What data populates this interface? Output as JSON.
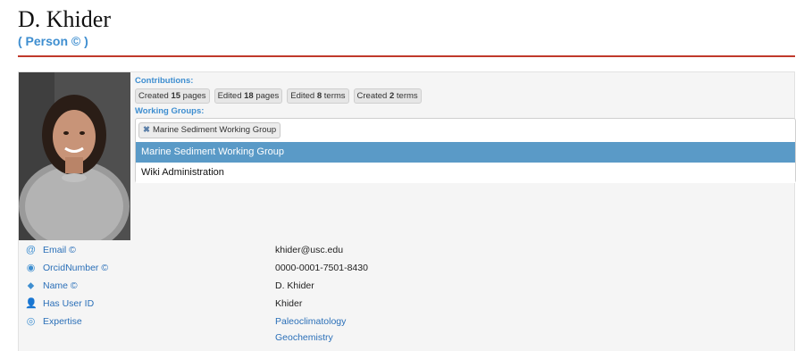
{
  "page": {
    "title": "D. Khider",
    "subtitle": "( Person © )"
  },
  "contributions": {
    "label": "Contributions:",
    "chips": [
      {
        "prefix": "Created",
        "count": "15",
        "suffix": "pages"
      },
      {
        "prefix": "Edited",
        "count": "18",
        "suffix": "pages"
      },
      {
        "prefix": "Edited",
        "count": "8",
        "suffix": "terms"
      },
      {
        "prefix": "Created",
        "count": "2",
        "suffix": "terms"
      }
    ]
  },
  "working_groups": {
    "label": "Working Groups:",
    "selected_token": "Marine Sediment Working Group",
    "remove_glyph": "✖",
    "options": [
      "Marine Sediment Working Group",
      "Wiki Administration"
    ]
  },
  "properties": [
    {
      "icon": "at-icon",
      "glyph": "@",
      "name": "Email ©",
      "values": [
        "khider@usc.edu"
      ]
    },
    {
      "icon": "orcid-icon",
      "glyph": "◉",
      "name": "OrcidNumber ©",
      "values": [
        "0000-0001-7501-8430"
      ]
    },
    {
      "icon": "tag-icon",
      "glyph": "⬥",
      "name": "Name ©",
      "values": [
        "D. Khider"
      ]
    },
    {
      "icon": "user-icon",
      "glyph": "👤",
      "name": "Has User ID",
      "values": [
        "Khider"
      ]
    },
    {
      "icon": "eye-icon",
      "glyph": "◎",
      "name": "Expertise",
      "values": [
        "Paleoclimatology",
        "Geochemistry"
      ]
    }
  ],
  "colors": {
    "accent": "#3e8ed0",
    "rule": "#c0392b",
    "selected_option": "#5a9ac7"
  }
}
